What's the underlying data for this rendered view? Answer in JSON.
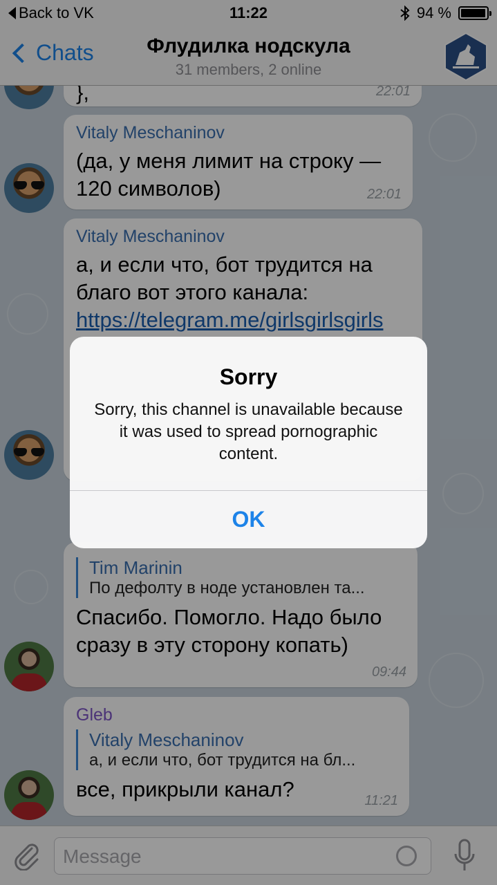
{
  "status_bar": {
    "back_label": "Back to VK",
    "time": "11:22",
    "battery_percent": "94 %",
    "battery_level": 0.94
  },
  "nav": {
    "back_label": "Chats",
    "title": "Флудилка нодскула",
    "subtitle": "31 members, 2 online"
  },
  "messages": [
    {
      "sender": "",
      "text": "},",
      "time": "22:01"
    },
    {
      "sender": "Vitaly Meschaninov",
      "text": "(да, у меня лимит на строку — 120 символов)",
      "time": "22:01"
    },
    {
      "sender": "Vitaly Meschaninov",
      "text": "а, и если что, бот трудится на благо вот этого канала:",
      "link": "https://telegram.me/girlsgirlsgirls"
    },
    {
      "reply_name": "Tim Marinin",
      "reply_text": "По дефолту в ноде установлен та...",
      "text": "Спасибо. Помогло. Надо было сразу в эту сторону копать)",
      "time": "09:44"
    },
    {
      "sender": "Gleb",
      "reply_name": "Vitaly Meschaninov",
      "reply_text": "а, и если что, бот трудится на бл...",
      "text": "все, прикрыли канал?",
      "time": "11:21"
    }
  ],
  "input": {
    "placeholder": "Message"
  },
  "alert": {
    "title": "Sorry",
    "message": "Sorry, this channel is unavailable because it was used to spread pornographic content.",
    "button": "OK"
  },
  "colors": {
    "accent": "#1d83e8",
    "sender_vitaly": "#3a6fb0",
    "sender_gleb": "#7d55c7"
  }
}
